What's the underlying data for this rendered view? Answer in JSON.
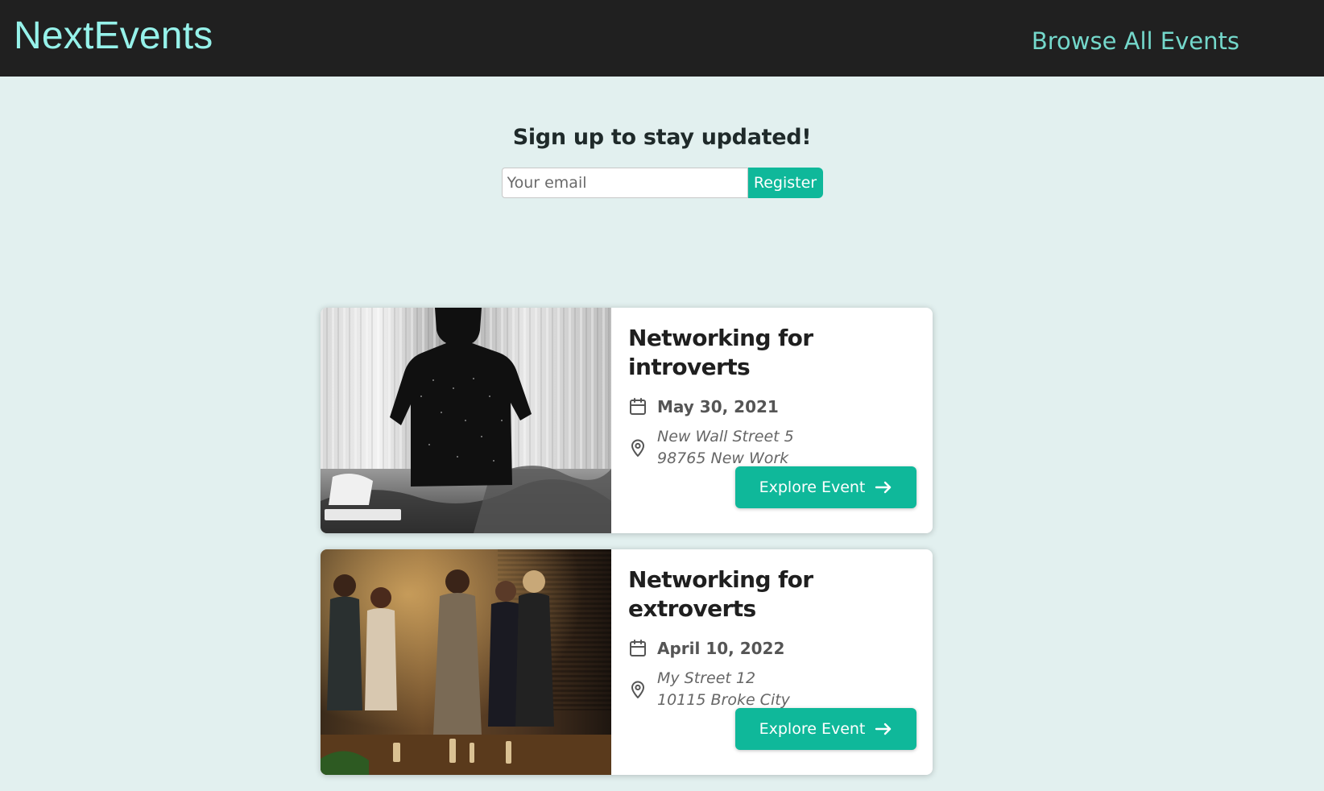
{
  "header": {
    "logo": "NextEvents",
    "nav_link": "Browse All Events"
  },
  "signup": {
    "heading": "Sign up to stay updated!",
    "email_placeholder": "Your email",
    "register_label": "Register"
  },
  "events": [
    {
      "title": "Networking for introverts",
      "date": "May 30, 2021",
      "address_line1": "New Wall Street 5",
      "address_line2": "98765 New Work",
      "button_label": "Explore Event",
      "image_icon": "person-sitting-on-bed-photo"
    },
    {
      "title": "Networking for extroverts",
      "date": "April 10, 2022",
      "address_line1": "My Street 12",
      "address_line2": "10115 Broke City",
      "button_label": "Explore Event",
      "image_icon": "people-at-party-photo"
    }
  ],
  "colors": {
    "header_bg": "#202020",
    "logo": "#96f2ea",
    "nav_link": "#74d8cb",
    "page_bg": "#e2f0ef",
    "accent": "#0fb89a"
  }
}
